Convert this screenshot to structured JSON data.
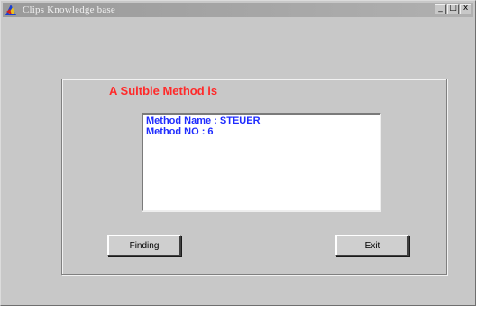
{
  "window": {
    "title": "Clips Knowledge base",
    "controls": [
      "_",
      "□",
      "x"
    ]
  },
  "dialog": {
    "heading": "A Suitble Method is",
    "result_lines": [
      "Method Name : STEUER",
      "Method NO : 6"
    ]
  },
  "buttons": {
    "finding_label": "Finding",
    "exit_label": "Exit"
  },
  "colors": {
    "heading": "#ff2a2a",
    "result_text": "#1f2cff",
    "window_bg": "#c8c8c8"
  }
}
